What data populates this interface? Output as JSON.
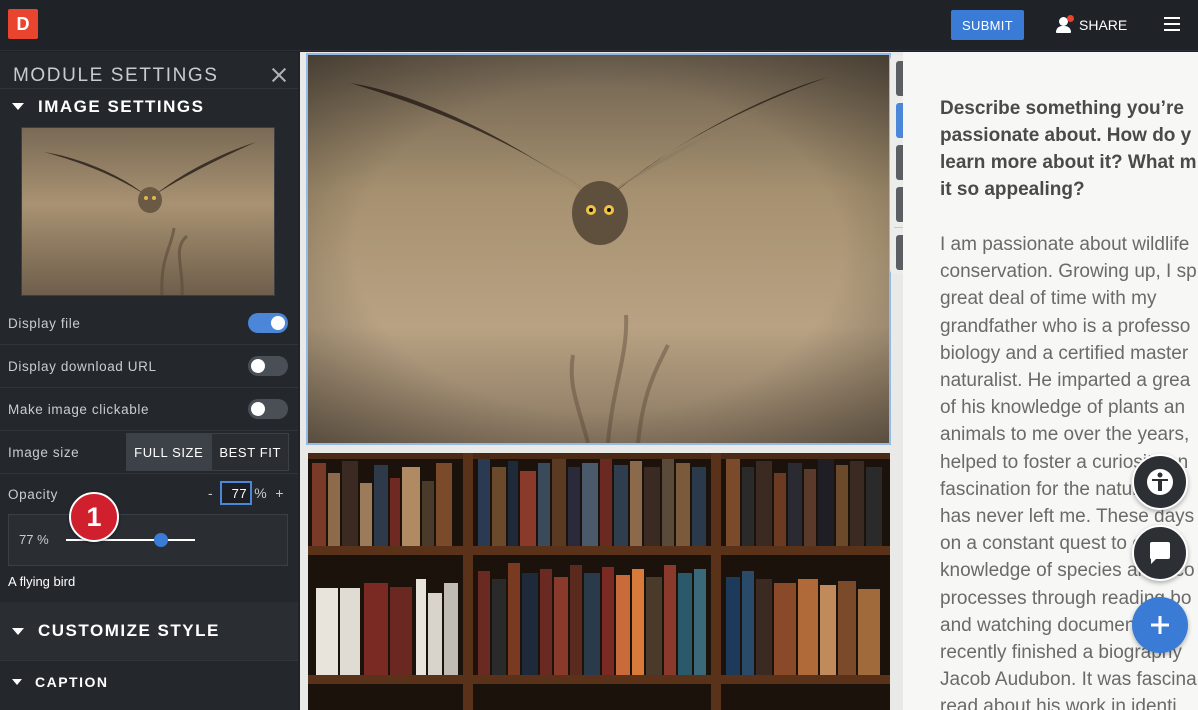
{
  "topbar": {
    "logo_letter": "D",
    "submit_label": "SUBMIT",
    "share_label": "SHARE"
  },
  "sidebar": {
    "title": "MODULE SETTINGS",
    "image_settings_label": "IMAGE SETTINGS",
    "rows": {
      "display_file": {
        "label": "Display file",
        "on": true
      },
      "display_download_url": {
        "label": "Display download URL",
        "on": false
      },
      "make_clickable": {
        "label": "Make image clickable",
        "on": false
      }
    },
    "image_size": {
      "label": "Image size",
      "options": [
        "FULL SIZE",
        "BEST FIT"
      ],
      "selected": "FULL SIZE"
    },
    "opacity": {
      "label": "Opacity",
      "minus": "-",
      "plus": "+",
      "value": "77",
      "unit": "%",
      "slider_label": "77 %",
      "slider_value": 0.77
    },
    "badge_number": "1",
    "caption_text": "A flying bird",
    "customize_style_label": "CUSTOMIZE STYLE",
    "caption_label": "CAPTION"
  },
  "content": {
    "question": "Describe something you’re\npassionate about. How do y\nlearn more about it? What m\nit so appealing?",
    "answer": "I am passionate about wildlife\nconservation. Growing up, I sp\ngreat deal of time with my\ngrandfather who is a professo\nbiology and a certified master\nnaturalist. He imparted a grea\nof his knowledge of plants an\nanimals to me over the years,\nhelped to foster a curiosity an\nfascination for the natural wo\nhas never left me. These days\non a constant quest to expan\nknowledge of species and eco\nprocesses through reading bo\nand watching documentaries.\nrecently finished a biography\nJacob Audubon. It was fascina\nread about his work in identi"
  },
  "colors": {
    "accent": "#3a7bd5",
    "badge": "#d0202e",
    "logo": "#e8442e"
  }
}
